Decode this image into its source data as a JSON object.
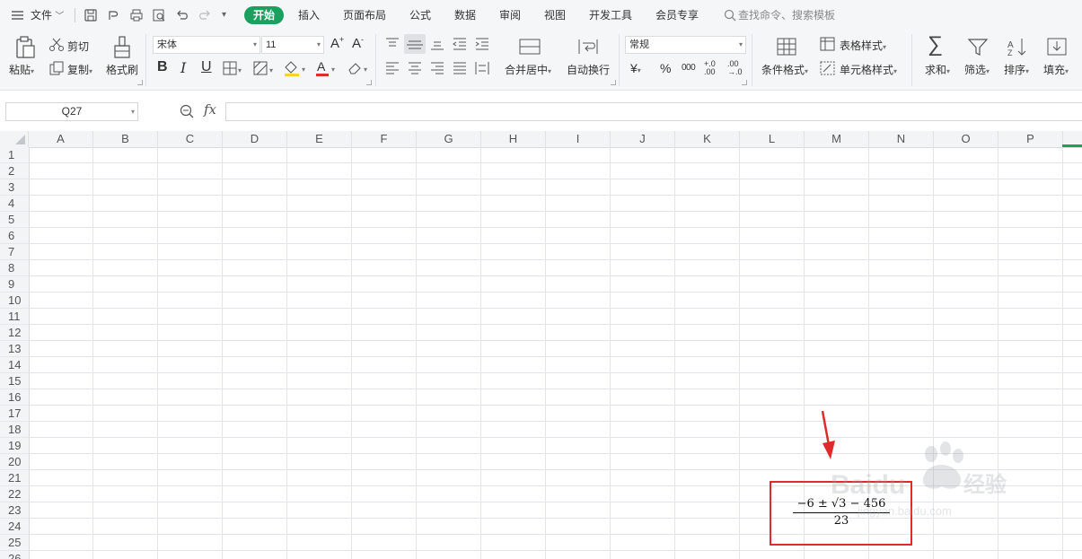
{
  "menubar": {
    "file_label": "文件",
    "tabs": [
      "开始",
      "插入",
      "页面布局",
      "公式",
      "数据",
      "审阅",
      "视图",
      "开发工具",
      "会员专享"
    ],
    "search_placeholder": "查找命令、搜索模板"
  },
  "ribbon": {
    "clipboard": {
      "paste": "粘贴",
      "cut": "剪切",
      "copy": "复制",
      "format_painter": "格式刷"
    },
    "font": {
      "name": "宋体",
      "size": "11"
    },
    "alignment": {
      "merge_center": "合并居中",
      "wrap_text": "自动换行"
    },
    "number": {
      "format": "常规",
      "currency_symbol": "¥",
      "percent_symbol": "%",
      "thousands": "000",
      "inc_decimal": "+.0 .00",
      "dec_decimal": ".00 →.0"
    },
    "styles": {
      "conditional_format": "条件格式",
      "table_style": "表格样式",
      "cell_style": "单元格样式"
    },
    "editing": {
      "sum": "求和",
      "filter": "筛选",
      "sort": "排序",
      "fill": "填充"
    }
  },
  "formula_bar": {
    "name_box": "Q27",
    "fx": "fx",
    "content": ""
  },
  "columns": [
    "A",
    "B",
    "C",
    "D",
    "E",
    "F",
    "G",
    "H",
    "I",
    "J",
    "K",
    "L",
    "M",
    "N",
    "O",
    "P"
  ],
  "rows": [
    "1",
    "2",
    "3",
    "4",
    "5",
    "6",
    "7",
    "8",
    "9",
    "10",
    "11",
    "12",
    "13",
    "14",
    "15",
    "16",
    "17",
    "18",
    "19",
    "20",
    "21",
    "22",
    "23",
    "24",
    "25",
    "26"
  ],
  "equation": {
    "numerator": "−6 ± √3 − 456",
    "denominator": "23"
  },
  "watermark": {
    "brand": "Baidu",
    "suffix": "经验",
    "url": "jingyan.baidu.com"
  },
  "colors": {
    "accent_green": "#1aa05f",
    "highlight_red": "#e02b2b",
    "font_color_red": "#e02b2b",
    "fill_yellow": "#f5d328"
  }
}
